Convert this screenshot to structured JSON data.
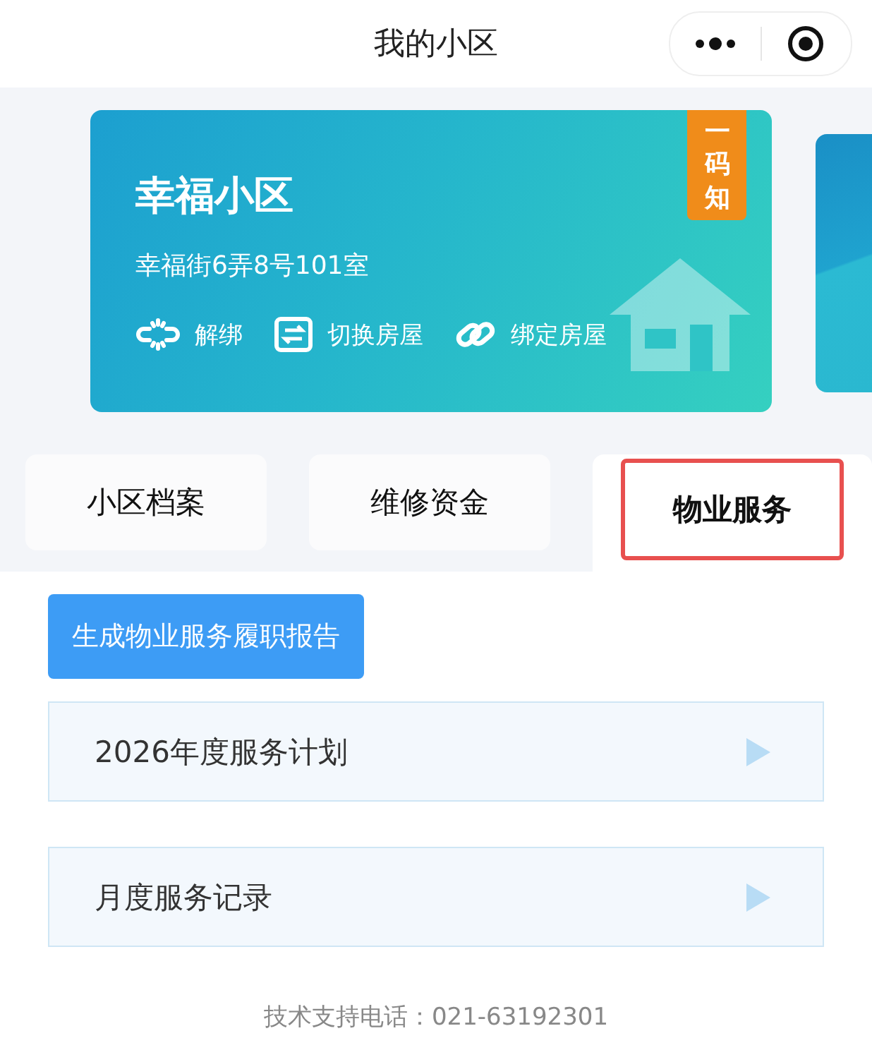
{
  "header": {
    "title": "我的小区"
  },
  "card": {
    "name": "幸福小区",
    "address": "幸福街6弄8号101室",
    "badge": "一码知",
    "actions": [
      {
        "kind": "unbind",
        "label": "解绑"
      },
      {
        "kind": "switch",
        "label": "切换房屋"
      },
      {
        "kind": "bind",
        "label": "绑定房屋"
      }
    ]
  },
  "tabs": [
    {
      "label": "小区档案",
      "selected": false
    },
    {
      "label": "维修资金",
      "selected": false
    },
    {
      "label": "物业服务",
      "selected": true
    }
  ],
  "report_button": "生成物业服务履职报告",
  "items": [
    {
      "label": "2026年度服务计划"
    },
    {
      "label": "月度服务记录"
    }
  ],
  "footer": "技术支持电话：021-63192301"
}
